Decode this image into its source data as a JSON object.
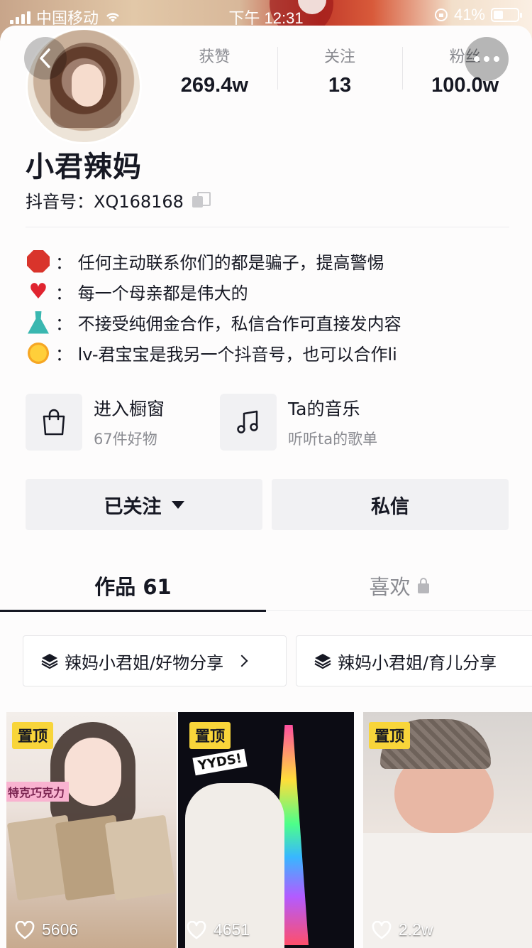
{
  "status_bar": {
    "carrier": "中国移动",
    "time": "下午 12:31",
    "battery": "41%"
  },
  "profile": {
    "stats": [
      {
        "label": "获赞",
        "value": "269.4w"
      },
      {
        "label": "关注",
        "value": "13"
      },
      {
        "label": "粉丝",
        "value": "100.0w"
      }
    ],
    "name": "小君辣妈",
    "douyin_id": "抖音号：XQ168168",
    "bio": [
      {
        "icon": "stop-sign-icon",
        "text": "：  任何主动联系你们的都是骗子，提高警惕"
      },
      {
        "icon": "red-heart-icon",
        "text": "：  每一个母亲都是伟大的"
      },
      {
        "icon": "dress-icon",
        "text": "：  不接受纯佣金合作，私信合作可直接发内容"
      },
      {
        "icon": "sun-face-icon",
        "text": "：  lv-君宝宝是我另一个抖音号，也可以合作li"
      }
    ]
  },
  "features": {
    "shop": {
      "title": "进入橱窗",
      "subtitle": "67件好物",
      "icon": "shopping-bag-icon"
    },
    "music": {
      "title": "Ta的音乐",
      "subtitle": "听听ta的歌单",
      "icon": "music-note-icon"
    }
  },
  "actions": {
    "follow": "已关注",
    "message": "私信"
  },
  "tabs": {
    "works": "作品 61",
    "likes": "喜欢"
  },
  "collections": [
    {
      "label": "辣妈小君姐/好物分享"
    },
    {
      "label": "辣妈小君姐/育儿分享"
    }
  ],
  "videos": [
    {
      "badge": "置顶",
      "likes": "5606",
      "overlay": "特克巧克力"
    },
    {
      "badge": "置顶",
      "likes": "4651",
      "overlay": "YYDS!"
    },
    {
      "badge": "置顶",
      "likes": "2.2w"
    }
  ],
  "colors": {
    "pin_badge": "#f8d53a",
    "text_primary": "#161823",
    "text_secondary": "#8a8b91",
    "button_bg": "#f1f1f3"
  }
}
